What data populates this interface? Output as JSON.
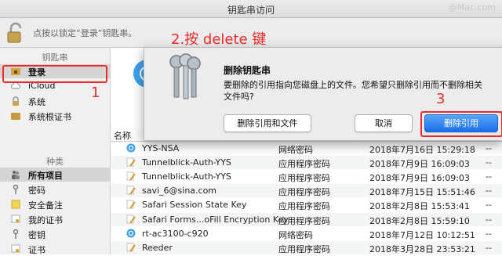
{
  "window": {
    "title": "钥匙串访问",
    "watermark": "@Mac.com"
  },
  "toolbar": {
    "lock_text": "点按以锁定“登录”钥匙串。"
  },
  "sidebar": {
    "keychains_header": "钥匙串",
    "keychains": [
      {
        "label": "登录",
        "icon": "folder-lock-icon",
        "selected": true
      },
      {
        "label": "iCloud",
        "icon": "cloud-icon"
      },
      {
        "label": "系统",
        "icon": "lock-icon"
      },
      {
        "label": "系统根证书",
        "icon": "folder-icon"
      }
    ],
    "categories_header": "种类",
    "categories": [
      {
        "label": "所有项目",
        "icon": "people-icon",
        "selected": true
      },
      {
        "label": "密码",
        "icon": "key-icon"
      },
      {
        "label": "安全备注",
        "icon": "note-icon"
      },
      {
        "label": "我的证书",
        "icon": "certificate-icon"
      },
      {
        "label": "密钥",
        "icon": "key-icon"
      },
      {
        "label": "证书",
        "icon": "certificate-icon"
      }
    ]
  },
  "annotations": {
    "step1": "1",
    "step2": "2.按 delete 键",
    "step3": "3"
  },
  "table": {
    "column_name": "名称",
    "rows": [
      {
        "name": "YYS-NSA",
        "kind": "网络密码",
        "date": "2018年7月16日 15:29:18",
        "extra": "--",
        "icon": "globe-icon"
      },
      {
        "name": "Tunnelblick-Auth-YYS",
        "kind": "应用程序密码",
        "date": "2018年7月9日 16:09:03",
        "extra": "--",
        "icon": "pencil-icon"
      },
      {
        "name": "Tunnelblick-Auth-YYS",
        "kind": "应用程序密码",
        "date": "2018年7月9日 16:09:03",
        "extra": "--",
        "icon": "pencil-icon"
      },
      {
        "name": "savi_6@sina.com",
        "kind": "应用程序密码",
        "date": "2018年7月15日 15:51:46",
        "extra": "--",
        "icon": "pencil-icon"
      },
      {
        "name": "Safari Session State Key",
        "kind": "应用程序密码",
        "date": "2018年2月8日 15:53:41",
        "extra": "--",
        "icon": "pencil-icon"
      },
      {
        "name": "Safari Forms...oFill Encryption Key",
        "kind": "应用程序密码",
        "date": "2018年2月8日 15:59:10",
        "extra": "--",
        "icon": "pencil-icon"
      },
      {
        "name": "rt-ac3100-c920",
        "kind": "网络密码",
        "date": "2018年7月12日 10:12:51",
        "extra": "--",
        "icon": "globe-icon"
      },
      {
        "name": "Reeder",
        "kind": "应用程序密码",
        "date": "2018年3月28日 23:53:21",
        "extra": "--",
        "icon": "pencil-icon"
      }
    ]
  },
  "dialog": {
    "title": "删除钥匙串",
    "message": "要删除的引用指向您磁盘上的文件。您希望只删除引用而不删除相关文件吗?",
    "btn_delete_files": "删除引用和文件",
    "btn_cancel": "取消",
    "btn_delete_ref": "删除引用"
  },
  "colors": {
    "accent": "#1a6fe9",
    "annotation": "#ee2a2a",
    "globe": "#3da1ee"
  }
}
